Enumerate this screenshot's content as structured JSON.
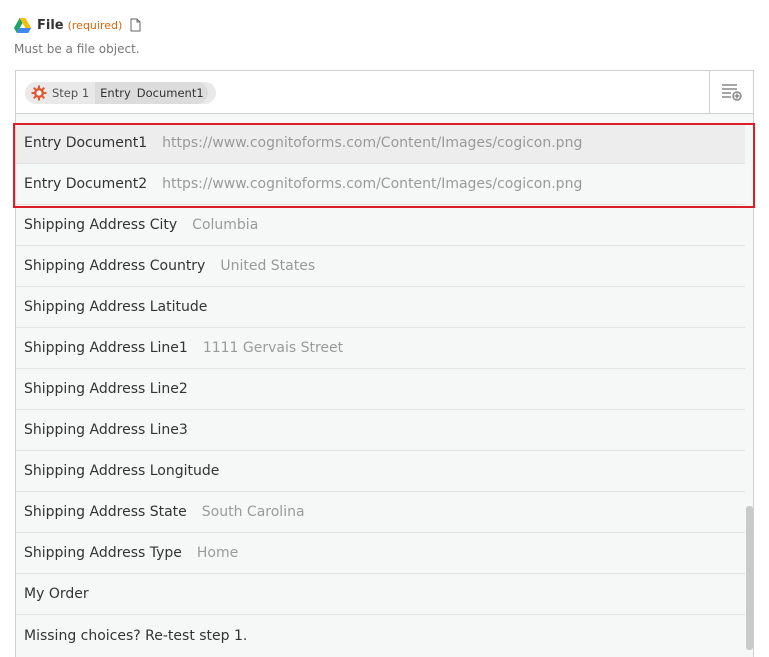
{
  "field": {
    "label": "File",
    "required": "(required)",
    "help": "Must be a file object."
  },
  "selected": {
    "step": "Step 1",
    "entry_a": "Entry",
    "entry_b": "Document1"
  },
  "options": [
    {
      "name": "Entry Document1",
      "value": "https://www.cognitoforms.com/Content/Images/cogicon.png"
    },
    {
      "name": "Entry Document2",
      "value": "https://www.cognitoforms.com/Content/Images/cogicon.png"
    },
    {
      "name": "Shipping Address City",
      "value": "Columbia"
    },
    {
      "name": "Shipping Address Country",
      "value": "United States"
    },
    {
      "name": "Shipping Address Latitude",
      "value": ""
    },
    {
      "name": "Shipping Address Line1",
      "value": "1111 Gervais Street"
    },
    {
      "name": "Shipping Address Line2",
      "value": ""
    },
    {
      "name": "Shipping Address Line3",
      "value": ""
    },
    {
      "name": "Shipping Address Longitude",
      "value": ""
    },
    {
      "name": "Shipping Address State",
      "value": "South Carolina"
    },
    {
      "name": "Shipping Address Type",
      "value": "Home"
    },
    {
      "name": "My Order",
      "value": ""
    }
  ],
  "retest": "Missing choices? Re-test step 1.",
  "colors": {
    "required": "#e0640a",
    "highlight_box": "#dc1f26"
  },
  "icons": {
    "field": "google-drive-icon",
    "doc": "document-icon",
    "app": "cog-icon",
    "options": "list-add-icon"
  }
}
